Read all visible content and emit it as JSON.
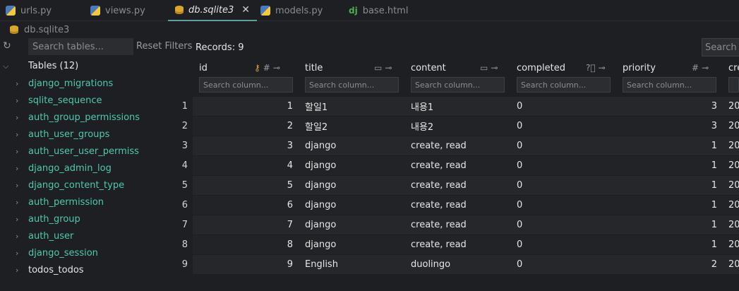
{
  "tabs": [
    {
      "label": "urls.py",
      "icon": "python-file-icon"
    },
    {
      "label": "views.py",
      "icon": "python-file-icon"
    },
    {
      "label": "db.sqlite3",
      "icon": "database-icon",
      "active": true
    },
    {
      "label": "models.py",
      "icon": "python-file-icon"
    },
    {
      "label": "base.html",
      "icon": "django-template-icon"
    }
  ],
  "breadcrumb": {
    "label": "db.sqlite3"
  },
  "toolbar": {
    "search_tables_placeholder": "Search tables...",
    "reset_filters": "Reset Filters",
    "records": "Records: 9",
    "search_placeholder": "Search"
  },
  "sidebar": {
    "header": "Tables (12)",
    "tables": [
      "django_migrations",
      "sqlite_sequence",
      "auth_group_permissions",
      "auth_user_groups",
      "auth_user_user_permiss",
      "django_admin_log",
      "django_content_type",
      "auth_permission",
      "auth_group",
      "auth_user",
      "django_session",
      "todos_todos"
    ]
  },
  "grid": {
    "columns": [
      "id",
      "title",
      "content",
      "completed",
      "priority",
      "cre"
    ],
    "search_placeholder": "Search column...",
    "rows": [
      {
        "n": "1",
        "id": "1",
        "title": "할일1",
        "content": "내용1",
        "completed": "0",
        "priority": "3",
        "created": "20"
      },
      {
        "n": "2",
        "id": "2",
        "title": "할일2",
        "content": "내용2",
        "completed": "0",
        "priority": "3",
        "created": "20"
      },
      {
        "n": "3",
        "id": "3",
        "title": "django",
        "content": "create, read",
        "completed": "0",
        "priority": "1",
        "created": "20"
      },
      {
        "n": "4",
        "id": "4",
        "title": "django",
        "content": "create, read",
        "completed": "0",
        "priority": "1",
        "created": "20"
      },
      {
        "n": "5",
        "id": "5",
        "title": "django",
        "content": "create, read",
        "completed": "0",
        "priority": "1",
        "created": "20"
      },
      {
        "n": "6",
        "id": "6",
        "title": "django",
        "content": "create, read",
        "completed": "0",
        "priority": "1",
        "created": "20"
      },
      {
        "n": "7",
        "id": "7",
        "title": "django",
        "content": "create, read",
        "completed": "0",
        "priority": "1",
        "created": "20"
      },
      {
        "n": "8",
        "id": "8",
        "title": "django",
        "content": "create, read",
        "completed": "0",
        "priority": "1",
        "created": "20"
      },
      {
        "n": "9",
        "id": "9",
        "title": "English",
        "content": "duolingo",
        "completed": "0",
        "priority": "2",
        "created": "20"
      }
    ]
  },
  "colors": {
    "accent": "#4ec9b0",
    "background": "#1e1f22",
    "panel": "#2b2d30"
  }
}
